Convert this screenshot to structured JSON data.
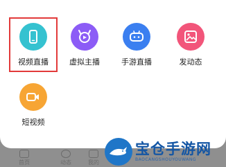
{
  "menu": {
    "items": [
      {
        "label": "视频直播",
        "icon": "phone-video-icon",
        "color": "#35c2d0"
      },
      {
        "label": "虚拟主播",
        "icon": "avatar-face-icon",
        "color": "#8c5cf6"
      },
      {
        "label": "手游直播",
        "icon": "gamepad-icon",
        "color": "#3b7ff0"
      },
      {
        "label": "发动态",
        "icon": "image-post-icon",
        "color": "#f2557a"
      },
      {
        "label": "短视频",
        "icon": "video-camera-icon",
        "color": "#f7a534"
      }
    ],
    "highlight_color": "#e23a3a"
  },
  "tabbar": {
    "items": [
      {
        "label": "首页"
      },
      {
        "label": "动态"
      },
      {
        "label": "我的"
      }
    ]
  },
  "watermark": {
    "title": "宝仓手游网",
    "subtitle": "BAOCANGSHOUYOUWANG"
  }
}
